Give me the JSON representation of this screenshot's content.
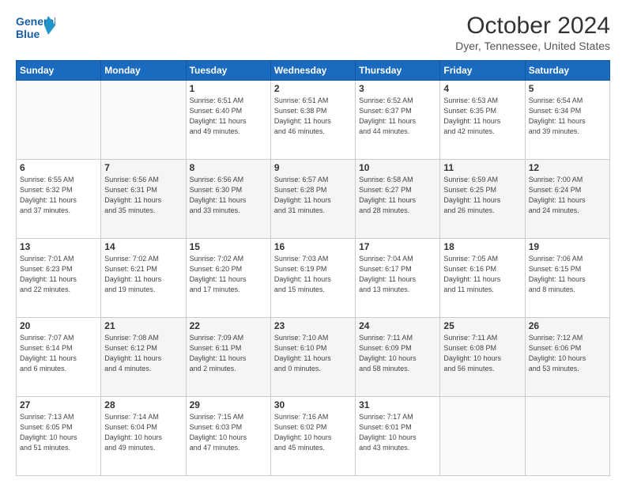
{
  "logo": {
    "line1": "General",
    "line2": "Blue"
  },
  "title": "October 2024",
  "subtitle": "Dyer, Tennessee, United States",
  "days_of_week": [
    "Sunday",
    "Monday",
    "Tuesday",
    "Wednesday",
    "Thursday",
    "Friday",
    "Saturday"
  ],
  "weeks": [
    [
      {
        "day": "",
        "detail": ""
      },
      {
        "day": "",
        "detail": ""
      },
      {
        "day": "1",
        "detail": "Sunrise: 6:51 AM\nSunset: 6:40 PM\nDaylight: 11 hours\nand 49 minutes."
      },
      {
        "day": "2",
        "detail": "Sunrise: 6:51 AM\nSunset: 6:38 PM\nDaylight: 11 hours\nand 46 minutes."
      },
      {
        "day": "3",
        "detail": "Sunrise: 6:52 AM\nSunset: 6:37 PM\nDaylight: 11 hours\nand 44 minutes."
      },
      {
        "day": "4",
        "detail": "Sunrise: 6:53 AM\nSunset: 6:35 PM\nDaylight: 11 hours\nand 42 minutes."
      },
      {
        "day": "5",
        "detail": "Sunrise: 6:54 AM\nSunset: 6:34 PM\nDaylight: 11 hours\nand 39 minutes."
      }
    ],
    [
      {
        "day": "6",
        "detail": "Sunrise: 6:55 AM\nSunset: 6:32 PM\nDaylight: 11 hours\nand 37 minutes."
      },
      {
        "day": "7",
        "detail": "Sunrise: 6:56 AM\nSunset: 6:31 PM\nDaylight: 11 hours\nand 35 minutes."
      },
      {
        "day": "8",
        "detail": "Sunrise: 6:56 AM\nSunset: 6:30 PM\nDaylight: 11 hours\nand 33 minutes."
      },
      {
        "day": "9",
        "detail": "Sunrise: 6:57 AM\nSunset: 6:28 PM\nDaylight: 11 hours\nand 31 minutes."
      },
      {
        "day": "10",
        "detail": "Sunrise: 6:58 AM\nSunset: 6:27 PM\nDaylight: 11 hours\nand 28 minutes."
      },
      {
        "day": "11",
        "detail": "Sunrise: 6:59 AM\nSunset: 6:25 PM\nDaylight: 11 hours\nand 26 minutes."
      },
      {
        "day": "12",
        "detail": "Sunrise: 7:00 AM\nSunset: 6:24 PM\nDaylight: 11 hours\nand 24 minutes."
      }
    ],
    [
      {
        "day": "13",
        "detail": "Sunrise: 7:01 AM\nSunset: 6:23 PM\nDaylight: 11 hours\nand 22 minutes."
      },
      {
        "day": "14",
        "detail": "Sunrise: 7:02 AM\nSunset: 6:21 PM\nDaylight: 11 hours\nand 19 minutes."
      },
      {
        "day": "15",
        "detail": "Sunrise: 7:02 AM\nSunset: 6:20 PM\nDaylight: 11 hours\nand 17 minutes."
      },
      {
        "day": "16",
        "detail": "Sunrise: 7:03 AM\nSunset: 6:19 PM\nDaylight: 11 hours\nand 15 minutes."
      },
      {
        "day": "17",
        "detail": "Sunrise: 7:04 AM\nSunset: 6:17 PM\nDaylight: 11 hours\nand 13 minutes."
      },
      {
        "day": "18",
        "detail": "Sunrise: 7:05 AM\nSunset: 6:16 PM\nDaylight: 11 hours\nand 11 minutes."
      },
      {
        "day": "19",
        "detail": "Sunrise: 7:06 AM\nSunset: 6:15 PM\nDaylight: 11 hours\nand 8 minutes."
      }
    ],
    [
      {
        "day": "20",
        "detail": "Sunrise: 7:07 AM\nSunset: 6:14 PM\nDaylight: 11 hours\nand 6 minutes."
      },
      {
        "day": "21",
        "detail": "Sunrise: 7:08 AM\nSunset: 6:12 PM\nDaylight: 11 hours\nand 4 minutes."
      },
      {
        "day": "22",
        "detail": "Sunrise: 7:09 AM\nSunset: 6:11 PM\nDaylight: 11 hours\nand 2 minutes."
      },
      {
        "day": "23",
        "detail": "Sunrise: 7:10 AM\nSunset: 6:10 PM\nDaylight: 11 hours\nand 0 minutes."
      },
      {
        "day": "24",
        "detail": "Sunrise: 7:11 AM\nSunset: 6:09 PM\nDaylight: 10 hours\nand 58 minutes."
      },
      {
        "day": "25",
        "detail": "Sunrise: 7:11 AM\nSunset: 6:08 PM\nDaylight: 10 hours\nand 56 minutes."
      },
      {
        "day": "26",
        "detail": "Sunrise: 7:12 AM\nSunset: 6:06 PM\nDaylight: 10 hours\nand 53 minutes."
      }
    ],
    [
      {
        "day": "27",
        "detail": "Sunrise: 7:13 AM\nSunset: 6:05 PM\nDaylight: 10 hours\nand 51 minutes."
      },
      {
        "day": "28",
        "detail": "Sunrise: 7:14 AM\nSunset: 6:04 PM\nDaylight: 10 hours\nand 49 minutes."
      },
      {
        "day": "29",
        "detail": "Sunrise: 7:15 AM\nSunset: 6:03 PM\nDaylight: 10 hours\nand 47 minutes."
      },
      {
        "day": "30",
        "detail": "Sunrise: 7:16 AM\nSunset: 6:02 PM\nDaylight: 10 hours\nand 45 minutes."
      },
      {
        "day": "31",
        "detail": "Sunrise: 7:17 AM\nSunset: 6:01 PM\nDaylight: 10 hours\nand 43 minutes."
      },
      {
        "day": "",
        "detail": ""
      },
      {
        "day": "",
        "detail": ""
      }
    ]
  ]
}
